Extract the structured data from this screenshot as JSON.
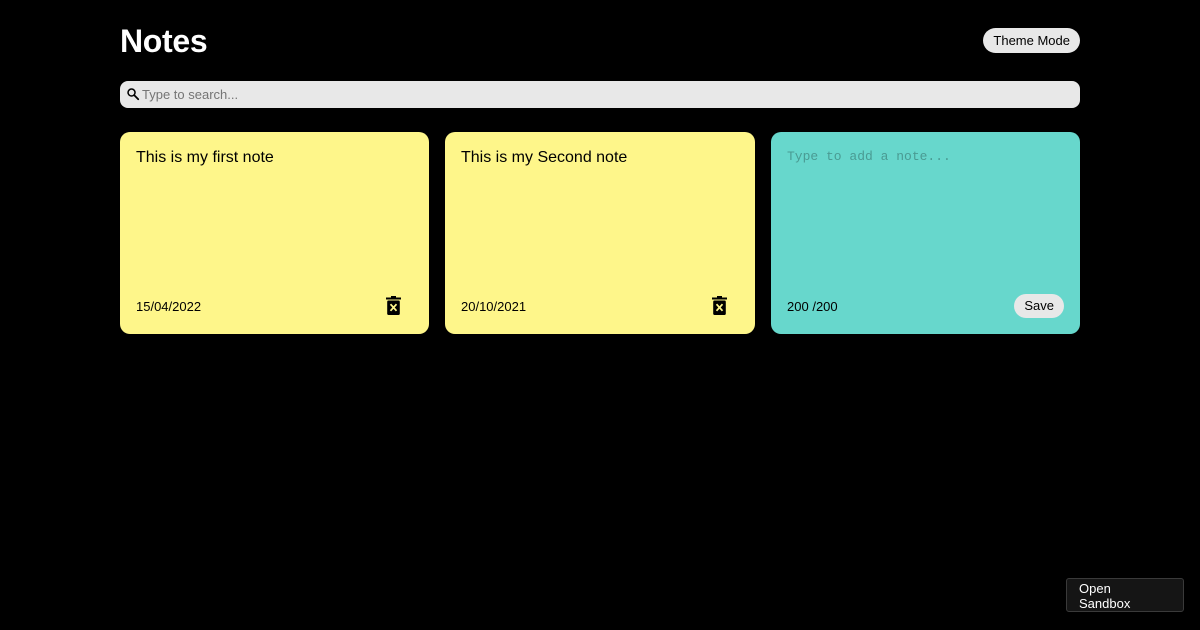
{
  "app": {
    "title": "Notes",
    "theme_button_label": "Theme Mode"
  },
  "search": {
    "placeholder": "Type to search...",
    "value": "",
    "icon": "search-icon"
  },
  "notes": [
    {
      "text": "This is my first note",
      "date": "15/04/2022",
      "icon": "delete-icon"
    },
    {
      "text": "This is my Second note",
      "date": "20/10/2021",
      "icon": "delete-icon"
    }
  ],
  "new_note": {
    "placeholder": "Type to add a note...",
    "value": "",
    "chars_remaining": "200",
    "char_limit": "/200",
    "save_label": "Save"
  },
  "sandbox": {
    "line1": "Open",
    "line2": "Sandbox"
  },
  "colors": {
    "background": "#000000",
    "note_yellow": "#fef68a",
    "note_new": "#67d7cc",
    "button_bg": "#e8e8e8"
  }
}
